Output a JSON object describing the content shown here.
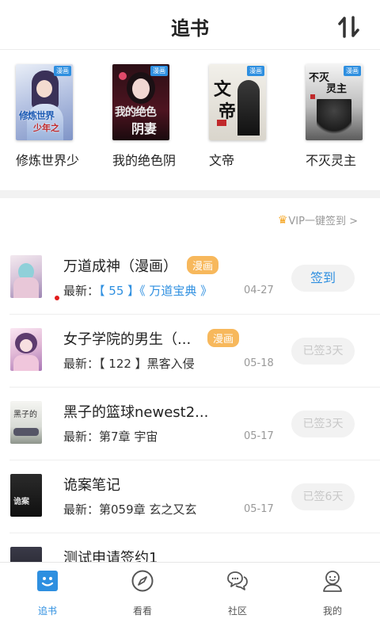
{
  "header": {
    "title": "追书",
    "sort_icon": "sort-arrows-icon"
  },
  "shelf": [
    {
      "title": "修炼世界少",
      "cover_text": "修炼世界少年之"
    },
    {
      "title": "我的绝色阴",
      "cover_text": "我的绝色阴妻"
    },
    {
      "title": "文帝",
      "cover_text": "文帝"
    },
    {
      "title": "不灭灵主",
      "cover_text": "不灭灵主"
    }
  ],
  "vip_link": "VIP一键签到 >",
  "list": [
    {
      "name": "万道成神（漫画）",
      "badge": "漫画",
      "latest_prefix": "最新：",
      "latest_chapter": "【 55 】《 万道宝典 》",
      "date": "04-27",
      "button": "签到",
      "active": true,
      "unread": true
    },
    {
      "name": "女子学院的男生（...",
      "badge": "漫画",
      "latest_prefix": "最新：",
      "latest_chapter": "【 122 】黑客入侵",
      "date": "05-18",
      "button": "已签3天",
      "active": false,
      "unread": false
    },
    {
      "name": "黑子的篮球newest2...",
      "badge": "",
      "latest_prefix": "最新：",
      "latest_chapter": "第7章 宇宙",
      "date": "05-17",
      "button": "已签3天",
      "active": false,
      "unread": false
    },
    {
      "name": "诡案笔记",
      "badge": "",
      "latest_prefix": "最新：",
      "latest_chapter": "第059章 玄之又玄",
      "date": "05-17",
      "button": "已签6天",
      "active": false,
      "unread": false
    },
    {
      "name": "测试申请签约1",
      "badge": "",
      "latest_prefix": "",
      "latest_chapter": "",
      "date": "",
      "button": "",
      "active": false,
      "unread": false
    }
  ],
  "tabs": [
    {
      "label": "追书",
      "icon": "face-icon",
      "active": true
    },
    {
      "label": "看看",
      "icon": "compass-icon",
      "active": false
    },
    {
      "label": "社区",
      "icon": "chat-bubbles-icon",
      "active": false
    },
    {
      "label": "我的",
      "icon": "user-icon",
      "active": false
    }
  ],
  "colors": {
    "accent": "#2e8fe0",
    "badge": "#f7b85c",
    "vip_crown": "#f5a623",
    "unread_dot": "#e21b1b"
  }
}
